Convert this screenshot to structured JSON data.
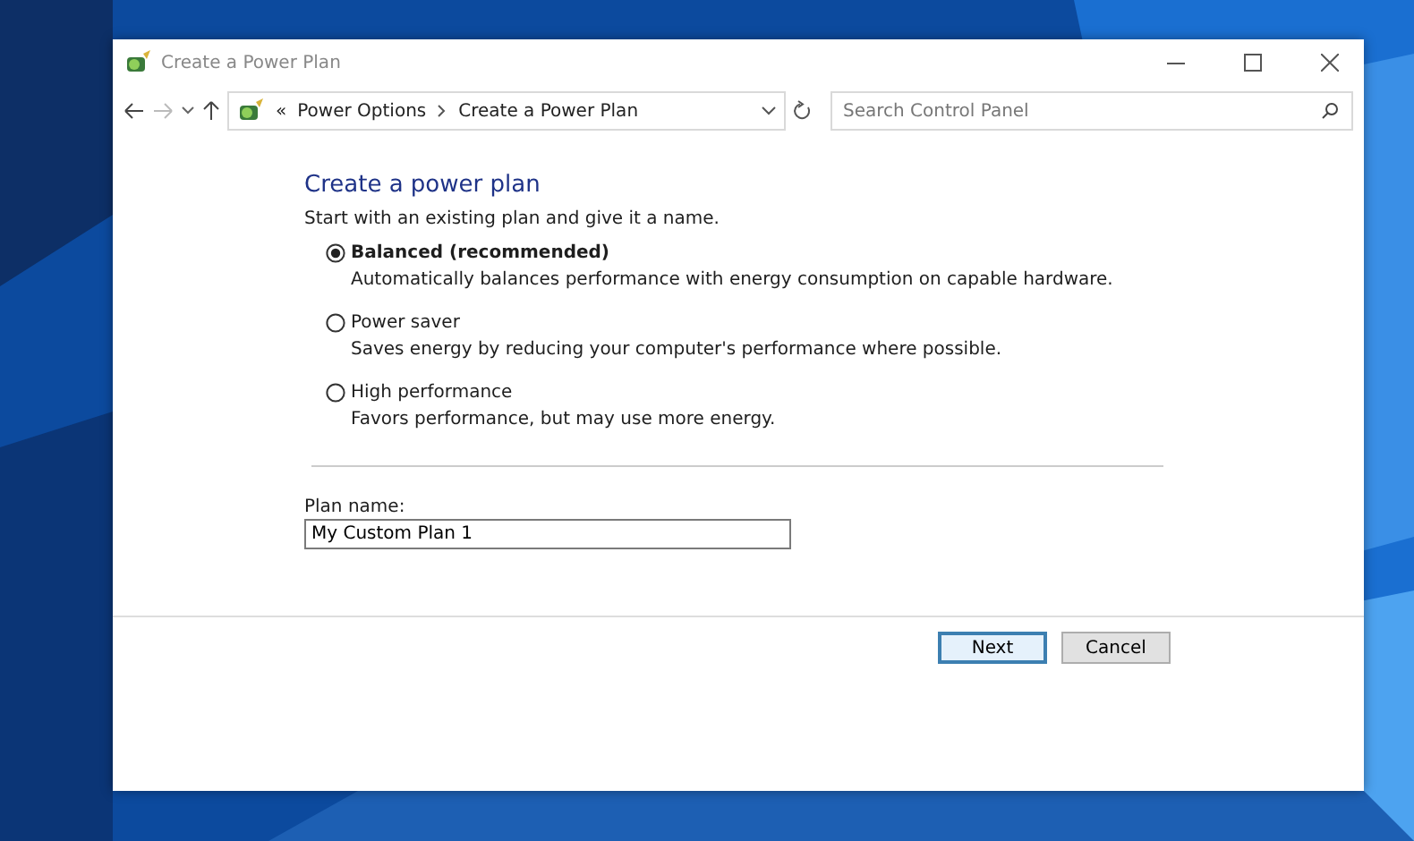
{
  "window": {
    "title": "Create a Power Plan"
  },
  "address_bar": {
    "overflow": "«",
    "crumbs": [
      "Power Options",
      "Create a Power Plan"
    ]
  },
  "search": {
    "placeholder": "Search Control Panel"
  },
  "heading": "Create a power plan",
  "intro": "Start with an existing plan and give it a name.",
  "plans": [
    {
      "label": "Balanced (recommended)",
      "description": "Automatically balances performance with energy consumption on capable hardware.",
      "selected": true
    },
    {
      "label": "Power saver",
      "description": "Saves energy by reducing your computer's performance where possible.",
      "selected": false
    },
    {
      "label": "High performance",
      "description": "Favors performance, but may use more energy.",
      "selected": false
    }
  ],
  "plan_name": {
    "label": "Plan name:",
    "value": "My Custom Plan 1"
  },
  "buttons": [
    {
      "label": "Next",
      "default": true
    },
    {
      "label": "Cancel",
      "default": false
    }
  ]
}
